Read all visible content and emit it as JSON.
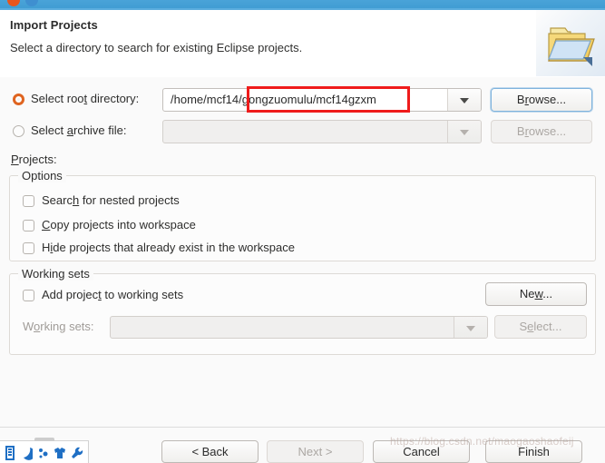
{
  "window": {
    "controls": [
      "close-button",
      "minimize-button"
    ]
  },
  "header": {
    "title": "Import Projects",
    "subtitle": "Select a directory to search for existing Eclipse projects.",
    "icon": "import-folder-icon"
  },
  "source": {
    "root": {
      "radio_label_pre": "Select roo",
      "radio_label_mn": "t",
      "radio_label_post": " directory:",
      "selected": true,
      "value": "/home/mcf14/gongzuomulu/mcf14gzxm",
      "browse_pre": "B",
      "browse_mn": "r",
      "browse_post": "owse...",
      "enabled": true
    },
    "archive": {
      "radio_label_pre": "Select ",
      "radio_label_mn": "a",
      "radio_label_post": "rchive file:",
      "selected": false,
      "value": "",
      "browse_pre": "B",
      "browse_mn": "r",
      "browse_post": "owse...",
      "enabled": false
    }
  },
  "projects": {
    "label_mn": "P",
    "label_post": "rojects:"
  },
  "options": {
    "group_title": "Options",
    "items": [
      {
        "pre": "Searc",
        "mn": "h",
        "post": " for nested projects",
        "checked": false
      },
      {
        "pre": "",
        "mn": "C",
        "post": "opy projects into workspace",
        "checked": false
      },
      {
        "pre": "H",
        "mn": "i",
        "post": "de projects that already exist in the workspace",
        "checked": false
      }
    ]
  },
  "working_sets": {
    "group_title": "Working sets",
    "add_checkbox": {
      "pre": "Add projec",
      "mn": "t",
      "post": " to working sets",
      "checked": false
    },
    "new_button": {
      "pre": "Ne",
      "mn": "w",
      "post": "..."
    },
    "label": {
      "pre": "W",
      "mn": "o",
      "post": "rking sets:"
    },
    "combo_value": "",
    "select_button": {
      "pre": "S",
      "mn": "e",
      "post": "lect..."
    }
  },
  "footer": {
    "buttons": [
      {
        "label": "< Back",
        "enabled": true
      },
      {
        "label": "Next >",
        "enabled": false
      },
      {
        "label": "Cancel",
        "enabled": true
      },
      {
        "label": "Finish",
        "enabled": true
      }
    ]
  },
  "watermark": "https://blog.csdn.net/maogaoshaofeij",
  "dock": {
    "icons": [
      "files-icon",
      "moon-icon",
      "sparkle-icon",
      "shirt-icon",
      "wrench-icon"
    ]
  },
  "annotation": {
    "color": "#ef1b1b",
    "highlighted_text": "/gongzuomulu/mcf14gzxm"
  }
}
